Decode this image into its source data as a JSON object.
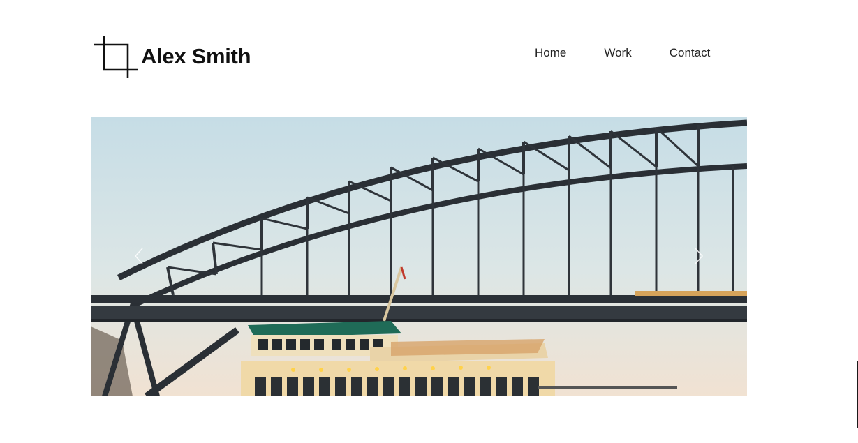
{
  "site": {
    "logo_text": "Alex Smith",
    "logo_icon": "crop-icon"
  },
  "nav": {
    "items": [
      {
        "label": "Home"
      },
      {
        "label": "Work"
      },
      {
        "label": "Contact"
      }
    ]
  },
  "slider": {
    "image_subject": "harbour-bridge-and-ferry-photo",
    "prev_icon": "chevron-left-icon",
    "next_icon": "chevron-right-icon"
  },
  "colors": {
    "text": "#111111",
    "background": "#ffffff",
    "sky_top": "#c9dfe6",
    "sky_bottom": "#efe4d6",
    "bridge": "#2a2f35",
    "ferry_hull": "#f0d9a8",
    "ferry_roof": "#1f6b57"
  }
}
